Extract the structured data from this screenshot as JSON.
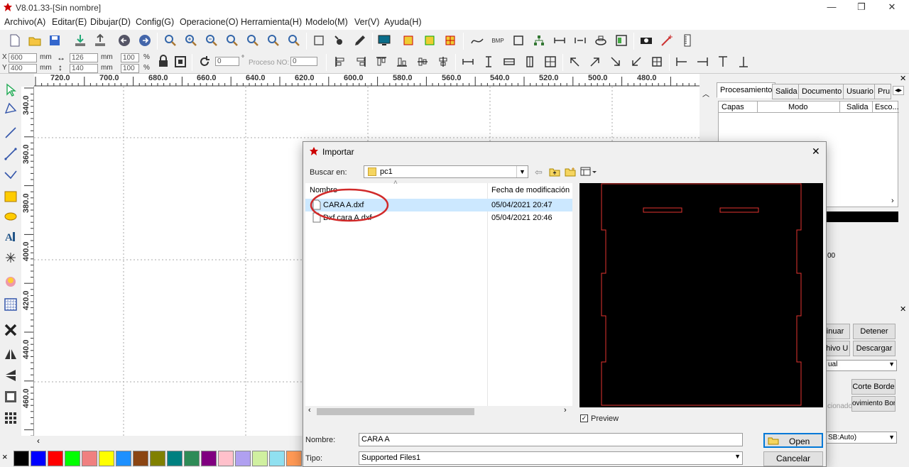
{
  "window": {
    "title": "V8.01.33-[Sin nombre]",
    "minimize": "—",
    "restore": "❐",
    "close": "✕"
  },
  "menu": [
    "Archivo(A)",
    "Editar(E)",
    "Dibujar(D)",
    "Config(G)",
    "Operacione(O)",
    "Herramienta(H)",
    "Modelo(M)",
    "Ver(V)",
    "Ayuda(H)"
  ],
  "position": {
    "x_label": "X",
    "y_label": "Y",
    "x_value": "600",
    "y_value": "400",
    "unit": "mm",
    "w_value": "126",
    "h_value": "140",
    "pct1": "100",
    "pct2": "100",
    "pct_unit": "%",
    "rotation": "0",
    "deg": "°",
    "process_label": "Proceso NO:",
    "process_value": "0"
  },
  "ruler": {
    "h_ticks": [
      "720.0",
      "700.0",
      "680.0",
      "660.0",
      "640.0",
      "620.0",
      "600.0",
      "580.0",
      "560.0",
      "540.0",
      "520.0",
      "500.0",
      "480.0"
    ],
    "v_ticks": [
      "340.0",
      "360.0",
      "380.0",
      "400.0",
      "420.0",
      "440.0",
      "460.0"
    ]
  },
  "palette": {
    "colors": [
      "#000000",
      "#0000ff",
      "#ff0000",
      "#00ff00",
      "#f08080",
      "#ffff00",
      "#1e90ff",
      "#8b4513",
      "#808000",
      "#008080",
      "#2e8b57",
      "#800080",
      "#ffc0cb",
      "#b0a0f0",
      "#d0f0a0",
      "#90e0f0",
      "#ff9955",
      "#d07090"
    ]
  },
  "right_panel": {
    "tabs": [
      "Procesamiento",
      "Salida",
      "Documento",
      "Usuario",
      "Pru"
    ],
    "columns": [
      "Capas",
      "Modo",
      "Salida",
      "Esco..."
    ],
    "partial_value": "00",
    "btn_continuar": "inuar",
    "btn_detener": "Detener",
    "btn_archivo": "chivo U",
    "btn_descargar": "Descargar",
    "select_modo": "ual",
    "btn_corte_borde": "Corte Borde",
    "label_seleccionado": "cionado",
    "btn_movimiento": "ovimiento Borc",
    "select_port": "SB:Auto)"
  },
  "dialog": {
    "title": "Importar",
    "close": "✕",
    "look_in_label": "Buscar en:",
    "look_in_value": "pc1",
    "col_name": "Nombre",
    "col_date": "Fecha de modificación",
    "files": [
      {
        "name": "CARA A.dxf",
        "date": "05/04/2021 20:47"
      },
      {
        "name": "Dxf cara A.dxf",
        "date": "05/04/2021 20:46"
      }
    ],
    "preview_label": "Preview",
    "name_label": "Nombre:",
    "name_value": "CARA A",
    "type_label": "Tipo:",
    "type_value": "Supported Files1",
    "open_button": "Open",
    "cancel_button": "Cancelar"
  }
}
